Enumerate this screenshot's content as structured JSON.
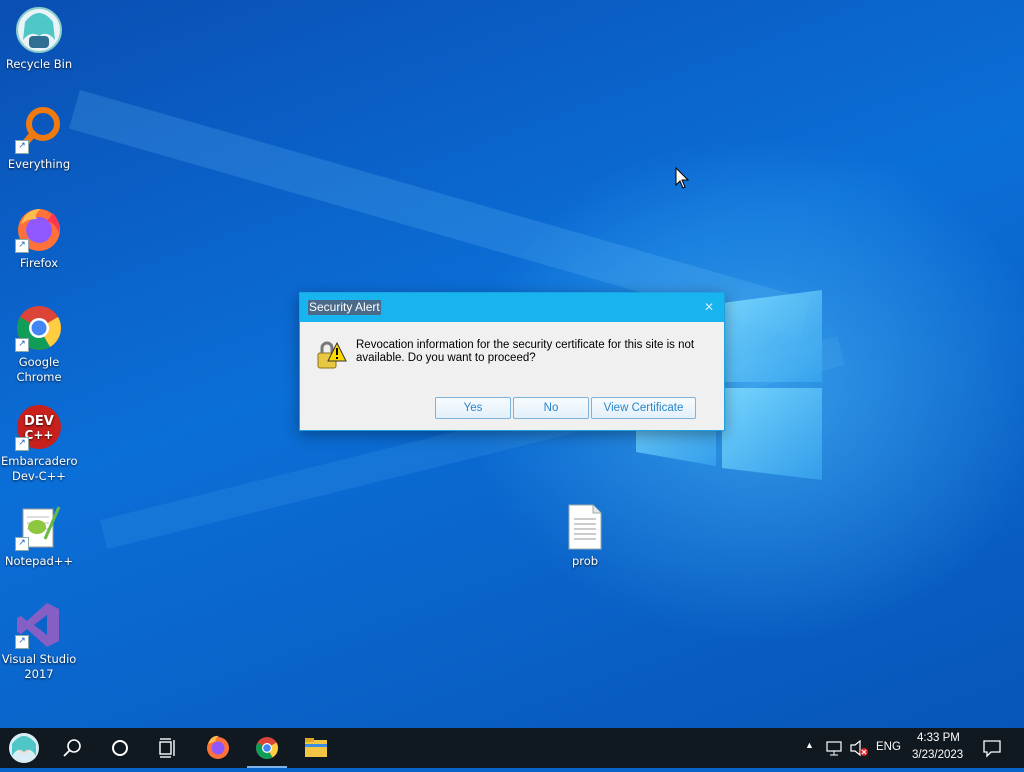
{
  "desktop": {
    "icons": [
      {
        "label_lines": [
          "Recycle Bin"
        ],
        "icon": "recycle-bin-icon"
      },
      {
        "label_lines": [
          "Everything"
        ],
        "icon": "everything-search-icon"
      },
      {
        "label_lines": [
          "Firefox"
        ],
        "icon": "firefox-icon"
      },
      {
        "label_lines": [
          "Google",
          "Chrome"
        ],
        "icon": "chrome-icon"
      },
      {
        "label_lines": [
          "Embarcadero",
          "Dev-C++"
        ],
        "icon": "devcpp-icon",
        "icon_text": [
          "DEV",
          "C++"
        ]
      },
      {
        "label_lines": [
          "Notepad++"
        ],
        "icon": "notepadpp-icon"
      },
      {
        "label_lines": [
          "Visual Studio",
          "2017"
        ],
        "icon": "visual-studio-icon"
      }
    ],
    "file": {
      "label": "prob",
      "icon": "text-file-icon"
    }
  },
  "dialog": {
    "title": "Security Alert",
    "close": "✕",
    "message": "Revocation information for the security certificate for this site is not available. Do you want to proceed?",
    "buttons": {
      "yes": "Yes",
      "no": "No",
      "view": "View Certificate"
    }
  },
  "taskbar": {
    "items": [
      "start-button",
      "search-icon",
      "cortana-icon",
      "task-view-icon",
      "firefox-icon",
      "chrome-icon",
      "file-explorer-icon"
    ],
    "tray": {
      "chevron": "▲",
      "language": "ENG",
      "time": "4:33 PM",
      "date": "3/23/2023"
    }
  },
  "colors": {
    "accent": "#17b4f0",
    "taskbar": "#101820",
    "desktop": "#0a63c9"
  }
}
